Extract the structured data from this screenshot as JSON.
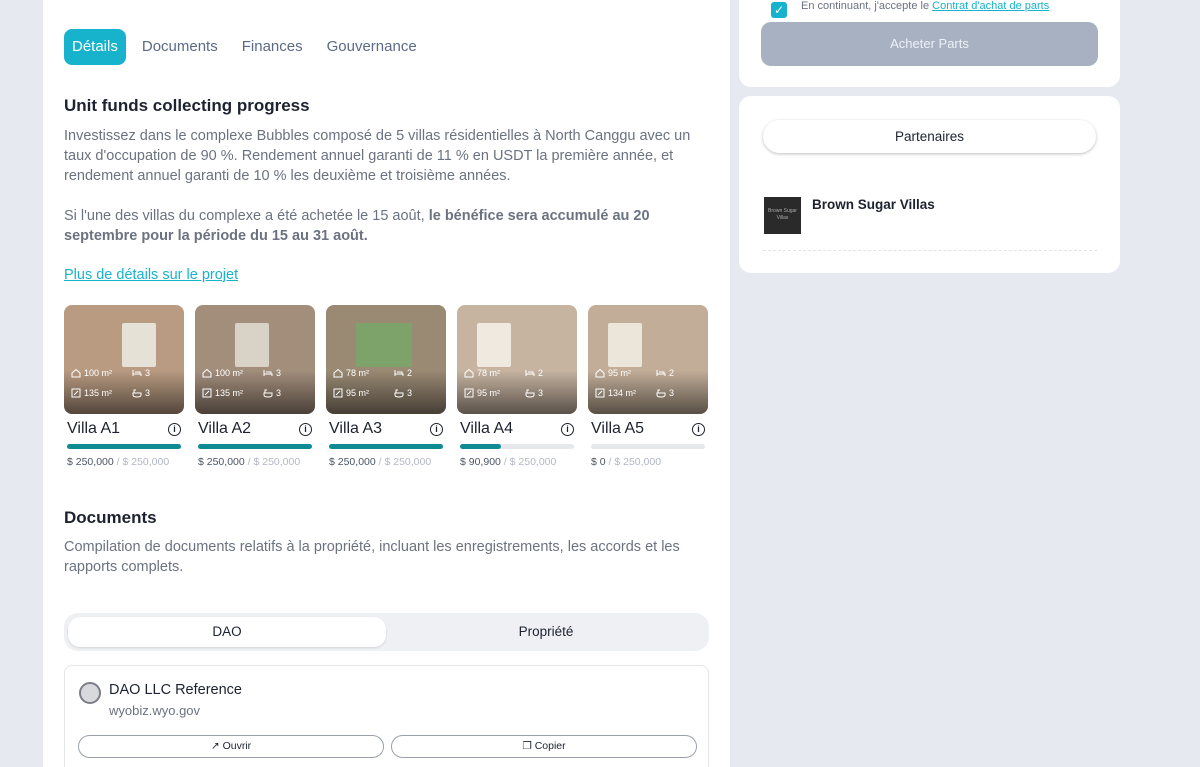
{
  "tabs": [
    "Détails",
    "Documents",
    "Finances",
    "Gouvernance"
  ],
  "progress": {
    "title": "Unit funds collecting progress",
    "para1": "Investissez dans le complexe Bubbles composé de 5 villas résidentielles à North Canggu avec un taux d'occupation de 90 %. Rendement annuel garanti de 11 % en USDT la première année, et rendement annuel garanti de 10 % les deuxième et troisième années.",
    "para2_plain": "Si l'une des villas du complexe a été achetée le 15 août, ",
    "para2_bold": "le bénéfice sera accumulé au 20 septembre pour la période du 15 au 31 août.",
    "link": "Plus de détails sur le projet"
  },
  "villas": [
    {
      "name": "Villa A1",
      "area": "100 m²",
      "beds": "3",
      "plot": "135 m²",
      "baths": "3",
      "raised": "$ 250,000",
      "total": "/ $ 250,000",
      "progress": 1.0,
      "bg": "#b99b82"
    },
    {
      "name": "Villa A2",
      "area": "100 m²",
      "beds": "3",
      "plot": "135 m²",
      "baths": "3",
      "raised": "$ 250,000",
      "total": "/ $ 250,000",
      "progress": 1.0,
      "bg": "#a38e7c"
    },
    {
      "name": "Villa A3",
      "area": "78 m²",
      "beds": "2",
      "plot": "95 m²",
      "baths": "3",
      "raised": "$ 250,000",
      "total": "/ $ 250,000",
      "progress": 1.0,
      "bg": "#9a8a74"
    },
    {
      "name": "Villa A4",
      "area": "78 m²",
      "beds": "2",
      "plot": "95 m²",
      "baths": "3",
      "raised": "$ 90,900",
      "total": "/ $ 250,000",
      "progress": 0.3636,
      "bg": "#c7b4a0"
    },
    {
      "name": "Villa A5",
      "area": "95 m²",
      "beds": "2",
      "plot": "134 m²",
      "baths": "3",
      "raised": "$ 0",
      "total": "/ $ 250,000",
      "progress": 0.0,
      "bg": "#c2ae98"
    }
  ],
  "documents": {
    "title": "Documents",
    "desc": "Compilation de documents relatifs à la propriété, incluant les enregistrements, les accords et les rapports complets.",
    "seg": [
      "DAO",
      "Propriété"
    ],
    "card": {
      "title": "DAO LLC Reference",
      "sub": "wyobiz.wyo.gov",
      "open": "Ouvrir",
      "copy": "Copier"
    }
  },
  "purchase": {
    "accept": "En continuant, j'accepte le ",
    "accept_link": "Contrat d'achat de parts",
    "buy": "Acheter Parts"
  },
  "partners": {
    "title": "Partenaires",
    "logo_text": "Brown Sugar Villas",
    "name": "Brown Sugar Villas"
  },
  "colors": {
    "accent": "#17b3cd",
    "progress": "#0f8b93",
    "buy_disabled": "#a8b1c2"
  }
}
